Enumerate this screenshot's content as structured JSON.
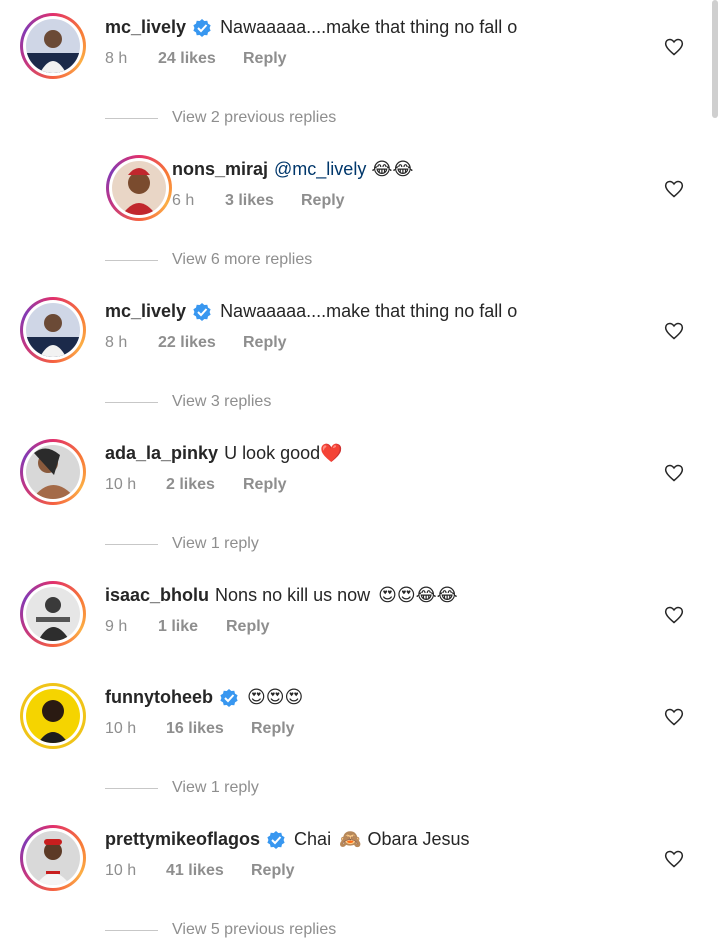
{
  "comments": [
    {
      "username": "mc_lively",
      "verified": true,
      "text": "Nawaaaaa....make that thing no fall o",
      "time": "8 h",
      "likes": "24 likes",
      "reply": "Reply"
    },
    {
      "username": "nons_miraj",
      "verified": false,
      "mention": "@mc_lively",
      "emoji": "😂😂",
      "time": "6 h",
      "likes": "3 likes",
      "reply": "Reply"
    },
    {
      "username": "mc_lively",
      "verified": true,
      "text": "Nawaaaaa....make that thing no fall o",
      "time": "8 h",
      "likes": "22 likes",
      "reply": "Reply"
    },
    {
      "username": "ada_la_pinky",
      "verified": false,
      "text": "U look good",
      "emoji": "❤️",
      "time": "10 h",
      "likes": "2 likes",
      "reply": "Reply"
    },
    {
      "username": "isaac_bholu",
      "verified": false,
      "text": "Nons no kill us now",
      "emoji": "😍😍😂😂",
      "time": "9 h",
      "likes": "1 like",
      "reply": "Reply"
    },
    {
      "username": "funnytoheeb",
      "verified": true,
      "emoji": "😍😍😍",
      "time": "10 h",
      "likes": "16 likes",
      "reply": "Reply"
    },
    {
      "username": "prettymikeoflagos",
      "verified": true,
      "text": "Chai",
      "emoji": "🙈",
      "text2": "Obara Jesus",
      "time": "10 h",
      "likes": "41 likes",
      "reply": "Reply"
    }
  ],
  "view_replies": [
    "View 2 previous replies",
    "View 6 more replies",
    "View 3 replies",
    "View 1 reply",
    "View 1 reply",
    "View 5 previous replies"
  ],
  "colors": {
    "verified": "#3897f0",
    "meta": "#8e8e8e",
    "text": "#262626",
    "mention": "#00376b"
  }
}
